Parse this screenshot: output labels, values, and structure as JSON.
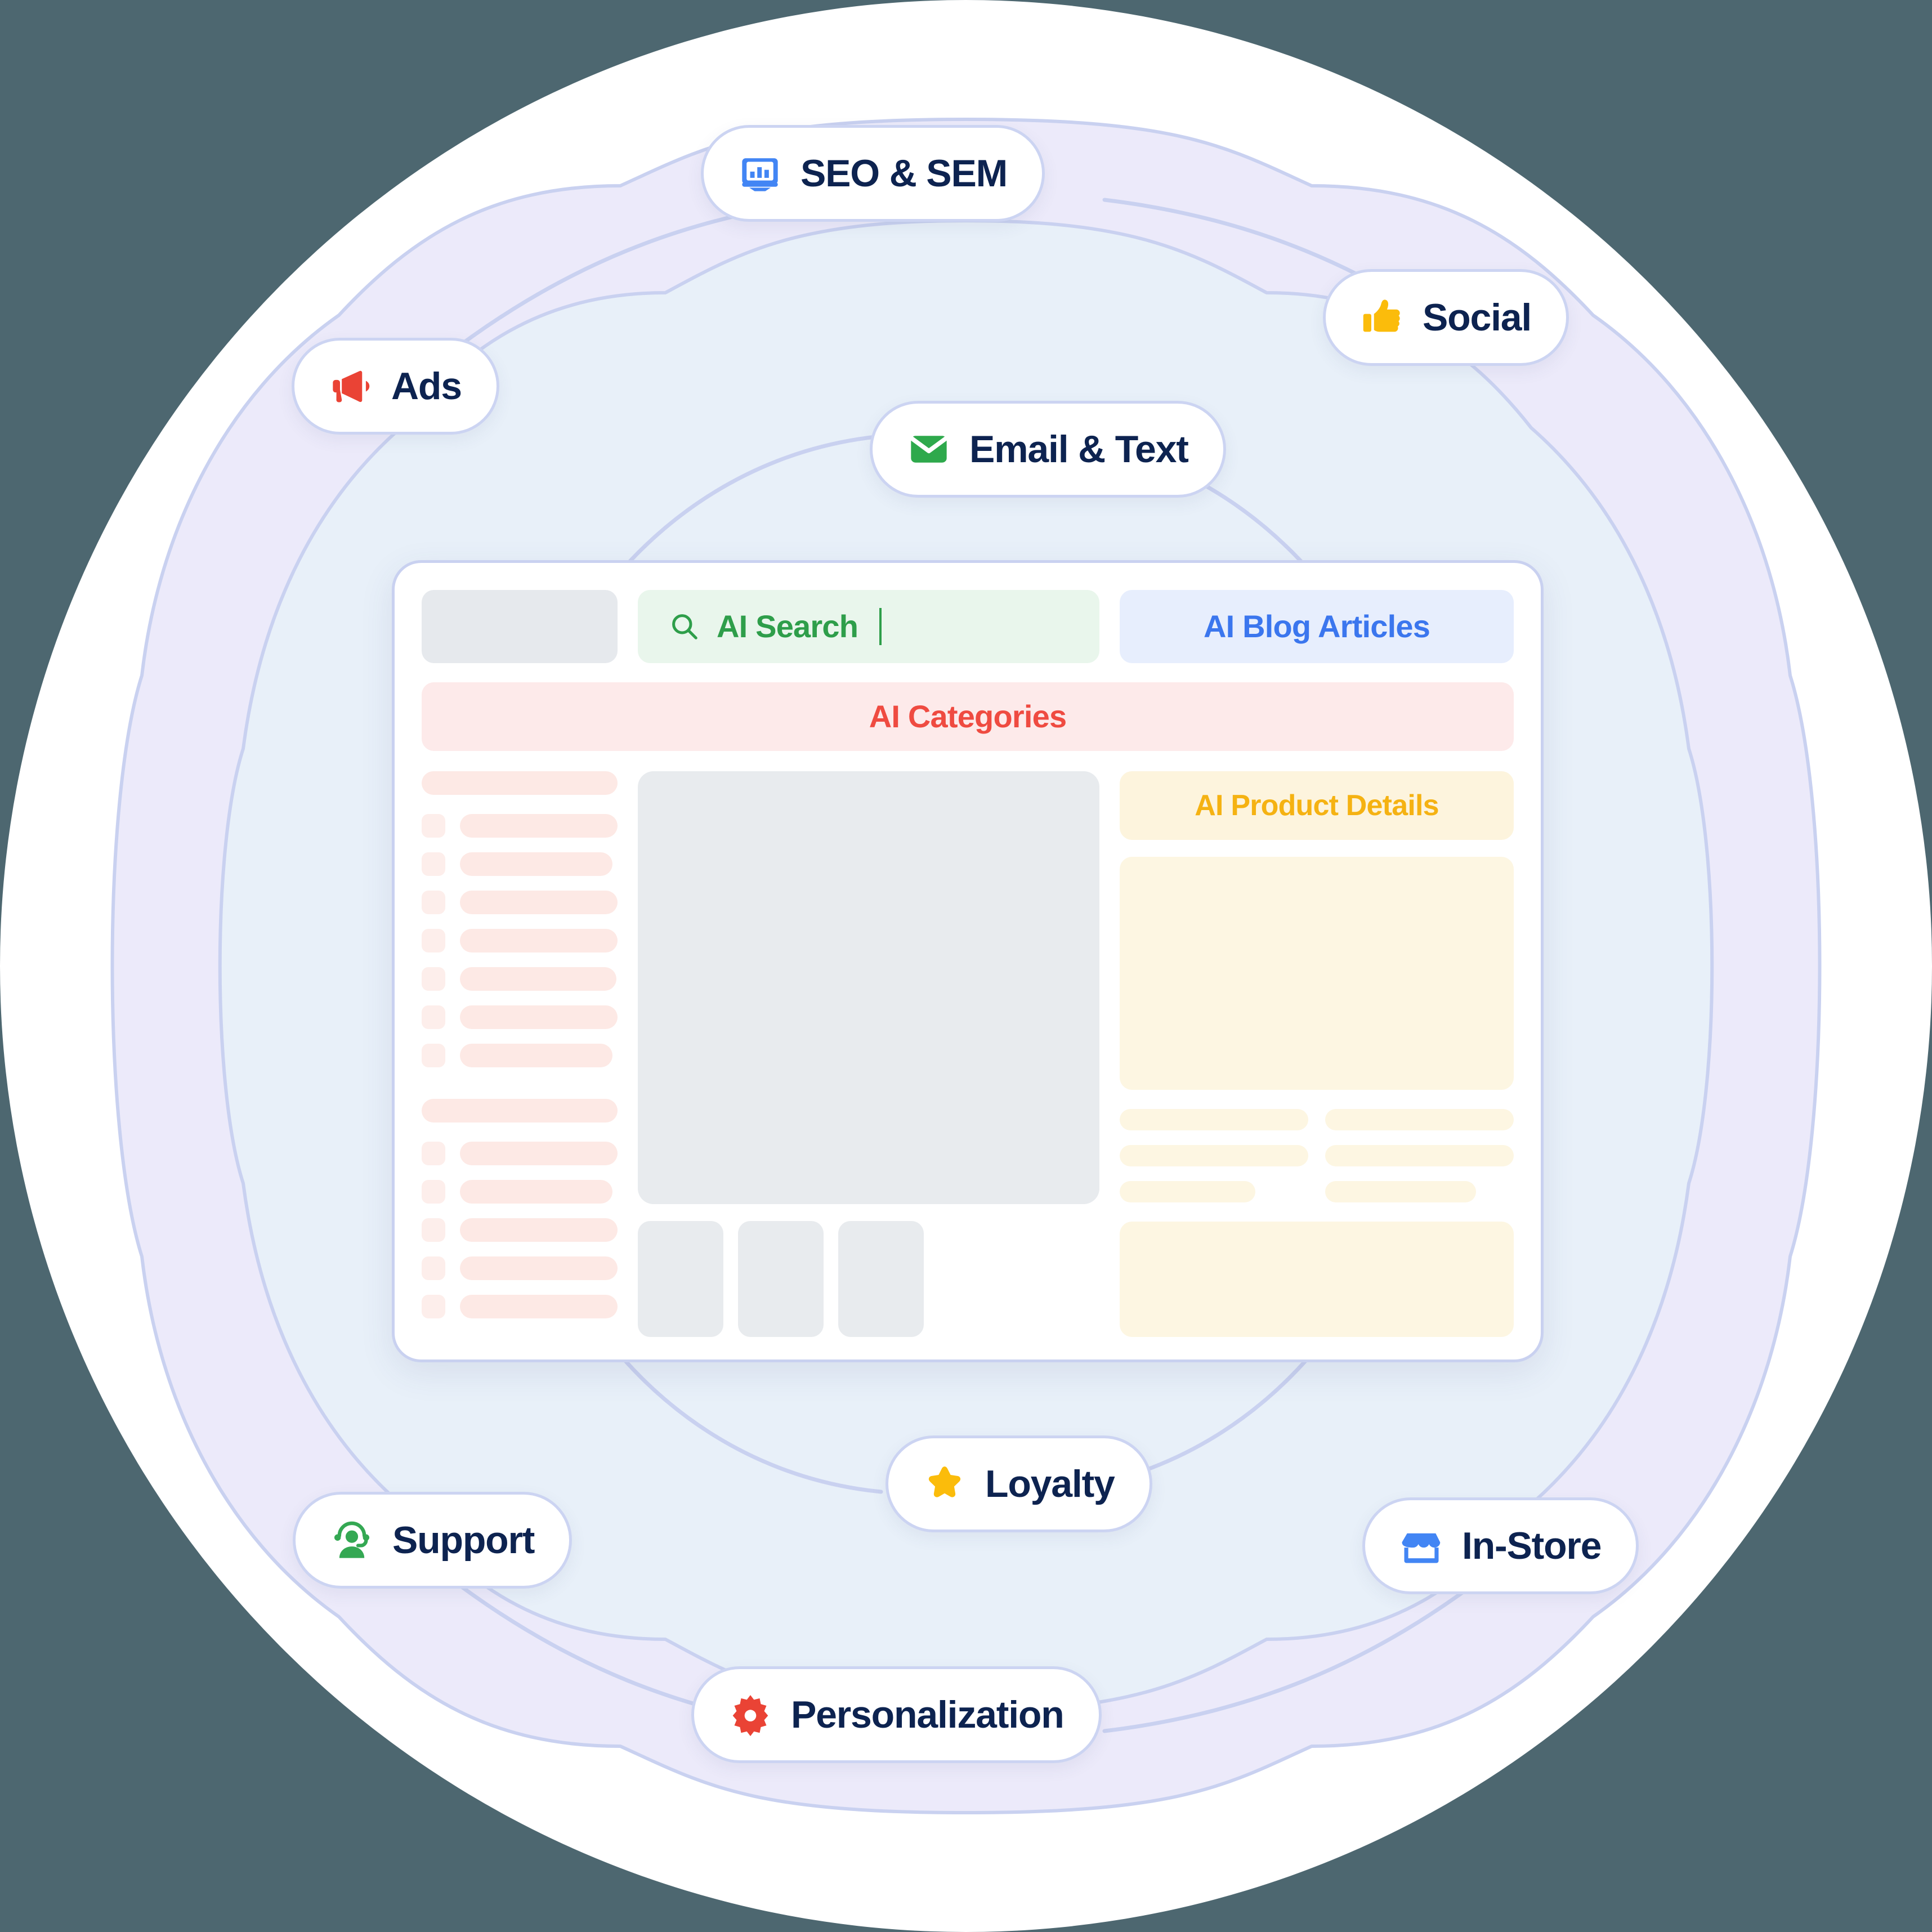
{
  "theme": {
    "page_background": "#4d6770",
    "ring_outer": "#ffffff",
    "ring_lavender": "#eceafa",
    "ring_blue": "#e8f0f9",
    "ring_stroke": "#c9d1f0",
    "pill_border": "#ccd4f2",
    "pill_text": "#0d2350"
  },
  "channels": [
    {
      "id": "seo",
      "label": "SEO & SEM",
      "icon": "chart-monitor-icon",
      "icon_color": "#3b76ee"
    },
    {
      "id": "social",
      "label": "Social",
      "icon": "thumbs-up-icon",
      "icon_color": "#fbbc0b"
    },
    {
      "id": "ads",
      "label": "Ads",
      "icon": "megaphone-icon",
      "icon_color": "#ea4335"
    },
    {
      "id": "email",
      "label": "Email & Text",
      "icon": "envelope-icon",
      "icon_color": "#2ea94c"
    },
    {
      "id": "support",
      "label": "Support",
      "icon": "headset-agent-icon",
      "icon_color": "#34a853"
    },
    {
      "id": "loyalty",
      "label": "Loyalty",
      "icon": "star-icon",
      "icon_color": "#fbbc0b"
    },
    {
      "id": "instore",
      "label": "In-Store",
      "icon": "storefront-icon",
      "icon_color": "#4285f4"
    },
    {
      "id": "personalization",
      "label": "Personalization",
      "icon": "gear-icon",
      "icon_color": "#ea4335"
    }
  ],
  "card": {
    "search": {
      "value": "AI Search",
      "placeholder": "AI Search",
      "icon": "search-icon",
      "color": "#2e9e4a",
      "background": "#e9f6ec"
    },
    "blog_button": {
      "label": "AI Blog Articles",
      "color": "#3b76ee",
      "background": "#e7eefd"
    },
    "categories_bar": {
      "label": "AI Categories",
      "color": "#ef4b41",
      "background": "#fdeaea"
    },
    "product_details": {
      "label": "AI Product Details",
      "color": "#f5b212",
      "background": "#fdf4dd"
    },
    "logo_placeholder_color": "#e6e9ed",
    "sidebar": {
      "accent": "#fde9e5",
      "groups": [
        {
          "header": true,
          "rows": [
            92,
            78,
            88,
            96,
            80,
            92,
            78
          ]
        },
        {
          "header": true,
          "rows": [
            96,
            78,
            90,
            98,
            82
          ]
        }
      ]
    },
    "gallery": {
      "hero_color": "#e8ebee",
      "thumbnail_count": 3
    },
    "product_lines": {
      "color": "#fdf6e2",
      "columns": [
        [
          100,
          100,
          72
        ],
        [
          100,
          100,
          80
        ]
      ]
    }
  }
}
